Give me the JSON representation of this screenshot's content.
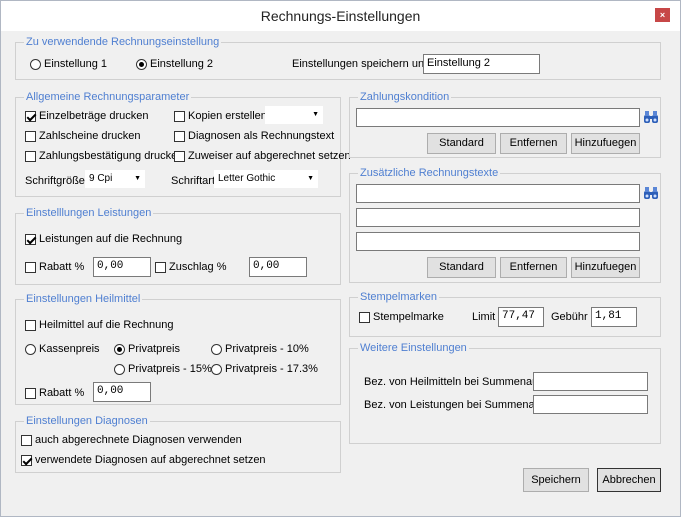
{
  "window": {
    "title": "Rechnungs-Einstellungen",
    "close_glyph": "×"
  },
  "rechnungseinstellung": {
    "legend": "Zu verwendende Rechnungseinstellung",
    "option1": "Einstellung 1",
    "option2": "Einstellung 2",
    "selected": "option2",
    "save_under_label": "Einstellungen speichern unter",
    "save_under_value": "Einstellung 2"
  },
  "allgemeine": {
    "legend": "Allgemeine Rechnungsparameter",
    "einzelbetraege": "Einzelbeträge drucken",
    "einzelbetraege_checked": true,
    "zahlscheine": "Zahlscheine drucken",
    "zahlscheine_checked": false,
    "zahlungsbestaetigung": "Zahlungsbestätigung drucken",
    "zahlungsbestaetigung_checked": false,
    "kopien": "Kopien erstellen",
    "kopien_checked": false,
    "kopien_value": "",
    "diagnosen_text": "Diagnosen als Rechnungstext",
    "diagnosen_text_checked": false,
    "zuweiser": "Zuweiser auf abgerechnet setzen",
    "zuweiser_checked": false,
    "schriftgroesse_label": "Schriftgröße",
    "schriftgroesse_value": "9 Cpi",
    "schriftart_label": "Schriftart",
    "schriftart_value": "Letter Gothic"
  },
  "leistungen": {
    "legend": "Einstelllungen Leistungen",
    "auf_rechnung": "Leistungen auf die Rechnung",
    "auf_rechnung_checked": true,
    "rabatt_label": "Rabatt %",
    "rabatt_checked": false,
    "rabatt_value": "0,00",
    "zuschlag_label": "Zuschlag %",
    "zuschlag_checked": false,
    "zuschlag_value": "0,00"
  },
  "heilmittel": {
    "legend": "Einstellungen Heilmittel",
    "auf_rechnung": "Heilmittel auf die Rechnung",
    "auf_rechnung_checked": false,
    "kassenpreis": "Kassenpreis",
    "privatpreis": "Privatpreis",
    "privatpreis_10": "Privatpreis - 10%",
    "privatpreis_15": "Privatpreis - 15%",
    "privatpreis_173": "Privatpreis - 17.3%",
    "selected": "privatpreis",
    "rabatt_label": "Rabatt %",
    "rabatt_checked": false,
    "rabatt_value": "0,00"
  },
  "diagnosen": {
    "legend": "Einstellungen Diagnosen",
    "abgerechnete": "auch abgerechnete Diagnosen verwenden",
    "abgerechnete_checked": false,
    "verwendete": "verwendete Diagnosen auf abgerechnet setzen",
    "verwendete_checked": true
  },
  "zahlungskondition": {
    "legend": "Zahlungskondition",
    "value": "",
    "btn_standard": "Standard",
    "btn_entfernen": "Entfernen",
    "btn_hinzufuegen": "Hinzufuegen"
  },
  "rechnungstexte": {
    "legend": "Zusätzliche Rechnungstexte",
    "line1": "",
    "line2": "",
    "line3": "",
    "btn_standard": "Standard",
    "btn_entfernen": "Entfernen",
    "btn_hinzufuegen": "Hinzufuegen"
  },
  "stempelmarken": {
    "legend": "Stempelmarken",
    "label": "Stempelmarke",
    "checked": false,
    "limit_label": "Limit",
    "limit_value": "77,47",
    "gebuehr_label": "Gebühr",
    "gebuehr_value": "1,81"
  },
  "weitere": {
    "legend": "Weitere Einstellungen",
    "heilmittel_label": "Bez. von Heilmitteln bei Summenaufst.",
    "heilmittel_value": "",
    "leistungen_label": "Bez. von Leistungen bei Summenaufst",
    "leistungen_value": ""
  },
  "footer": {
    "speichern": "Speichern",
    "abbrechen": "Abbrechen"
  },
  "colors": {
    "accent": "#4f7fd1",
    "close": "#c74747",
    "background": "#f0f0f0"
  },
  "icons": {
    "search": "binoculars-icon",
    "dropdown": "chevron-down-icon"
  }
}
